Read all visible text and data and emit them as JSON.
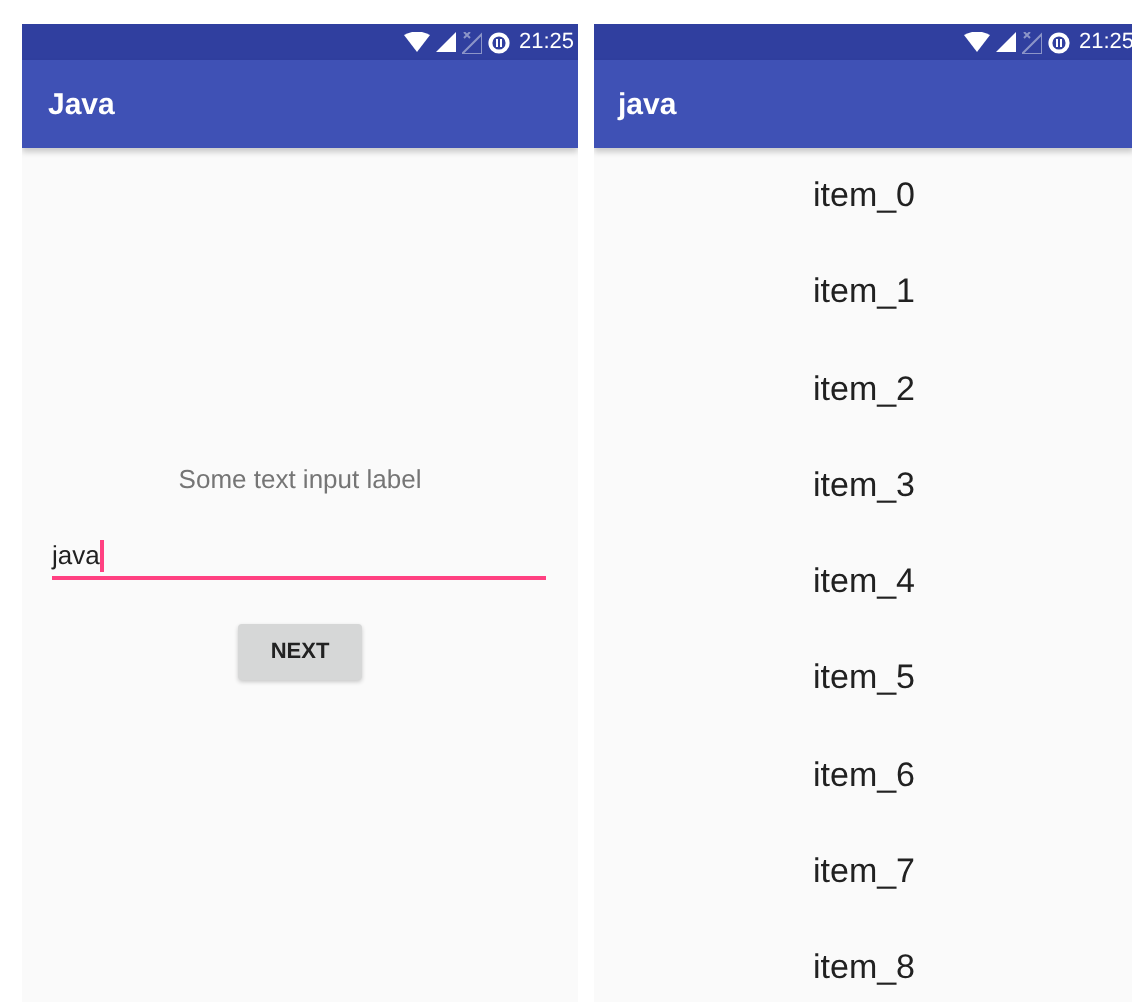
{
  "screens": [
    {
      "status_bar": {
        "time": "21:25"
      },
      "app_bar": {
        "title": "Java"
      },
      "form": {
        "label": "Some text input label",
        "input": {
          "value": "java",
          "focused": true
        },
        "button": "NEXT"
      }
    },
    {
      "status_bar": {
        "time": "21:25"
      },
      "app_bar": {
        "title": "java"
      },
      "list": {
        "items": [
          "item_0",
          "item_1",
          "item_2",
          "item_3",
          "item_4",
          "item_5",
          "item_6",
          "item_7",
          "item_8"
        ]
      }
    }
  ]
}
